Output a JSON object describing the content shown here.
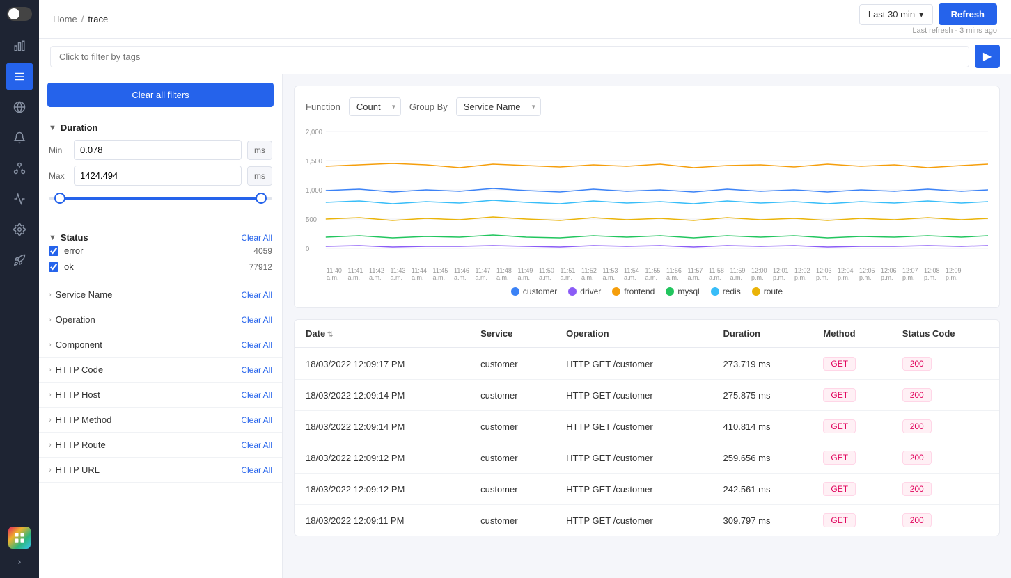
{
  "sidebar": {
    "icons": [
      {
        "name": "bar-chart-icon",
        "symbol": "▦",
        "active": false
      },
      {
        "name": "menu-icon",
        "symbol": "☰",
        "active": true
      },
      {
        "name": "globe-icon",
        "symbol": "◉",
        "active": false
      },
      {
        "name": "alert-icon",
        "symbol": "△",
        "active": false
      },
      {
        "name": "network-icon",
        "symbol": "⌘",
        "active": false
      },
      {
        "name": "line-chart-icon",
        "symbol": "⌇",
        "active": false
      },
      {
        "name": "settings-icon",
        "symbol": "⚙",
        "active": false
      },
      {
        "name": "rocket-icon",
        "symbol": "⚡",
        "active": false
      }
    ]
  },
  "topbar": {
    "breadcrumb_home": "Home",
    "breadcrumb_sep": "/",
    "breadcrumb_current": "trace",
    "time_picker_label": "Last 30 min",
    "refresh_label": "Refresh",
    "last_refresh": "Last refresh - 3 mins ago"
  },
  "filter_bar": {
    "placeholder": "Click to filter by tags"
  },
  "left_panel": {
    "clear_all_label": "Clear all filters",
    "duration": {
      "title": "Duration",
      "min_label": "Min",
      "min_value": "0.078",
      "min_unit": "ms",
      "max_label": "Max",
      "max_value": "1424.494",
      "max_unit": "ms"
    },
    "status": {
      "title": "Status",
      "clear_label": "Clear All",
      "items": [
        {
          "label": "error",
          "count": "4059",
          "checked": true
        },
        {
          "label": "ok",
          "count": "77912",
          "checked": true
        }
      ]
    },
    "filters": [
      {
        "label": "Service Name",
        "clear": "Clear All"
      },
      {
        "label": "Operation",
        "clear": "Clear All"
      },
      {
        "label": "Component",
        "clear": "Clear All"
      },
      {
        "label": "HTTP Code",
        "clear": "Clear All"
      },
      {
        "label": "HTTP Host",
        "clear": "Clear All"
      },
      {
        "label": "HTTP Method",
        "clear": "Clear All"
      },
      {
        "label": "HTTP Route",
        "clear": "Clear All"
      },
      {
        "label": "HTTP URL",
        "clear": "Clear All"
      }
    ]
  },
  "chart": {
    "function_label": "Function",
    "function_value": "Count",
    "group_by_label": "Group By",
    "group_by_value": "Service Name",
    "y_labels": [
      "2,000",
      "1,500",
      "1,000",
      "500",
      "0"
    ],
    "legend": [
      {
        "name": "customer",
        "color": "#3b82f6"
      },
      {
        "name": "driver",
        "color": "#8b5cf6"
      },
      {
        "name": "frontend",
        "color": "#f59e0b"
      },
      {
        "name": "mysql",
        "color": "#22c55e"
      },
      {
        "name": "redis",
        "color": "#38bdf8"
      },
      {
        "name": "route",
        "color": "#eab308"
      }
    ]
  },
  "table": {
    "columns": [
      {
        "label": "Date",
        "sortable": true
      },
      {
        "label": "Service",
        "sortable": false
      },
      {
        "label": "Operation",
        "sortable": false
      },
      {
        "label": "Duration",
        "sortable": false
      },
      {
        "label": "Method",
        "sortable": false
      },
      {
        "label": "Status Code",
        "sortable": false
      }
    ],
    "rows": [
      {
        "date": "18/03/2022 12:09:17 PM",
        "service": "customer",
        "operation": "HTTP GET /customer",
        "duration": "273.719 ms",
        "method": "GET",
        "status": "200"
      },
      {
        "date": "18/03/2022 12:09:14 PM",
        "service": "customer",
        "operation": "HTTP GET /customer",
        "duration": "275.875 ms",
        "method": "GET",
        "status": "200"
      },
      {
        "date": "18/03/2022 12:09:14 PM",
        "service": "customer",
        "operation": "HTTP GET /customer",
        "duration": "410.814 ms",
        "method": "GET",
        "status": "200"
      },
      {
        "date": "18/03/2022 12:09:12 PM",
        "service": "customer",
        "operation": "HTTP GET /customer",
        "duration": "259.656 ms",
        "method": "GET",
        "status": "200"
      },
      {
        "date": "18/03/2022 12:09:12 PM",
        "service": "customer",
        "operation": "HTTP GET /customer",
        "duration": "242.561 ms",
        "method": "GET",
        "status": "200"
      },
      {
        "date": "18/03/2022 12:09:11 PM",
        "service": "customer",
        "operation": "HTTP GET /customer",
        "duration": "309.797 ms",
        "method": "GET",
        "status": "200"
      }
    ]
  }
}
